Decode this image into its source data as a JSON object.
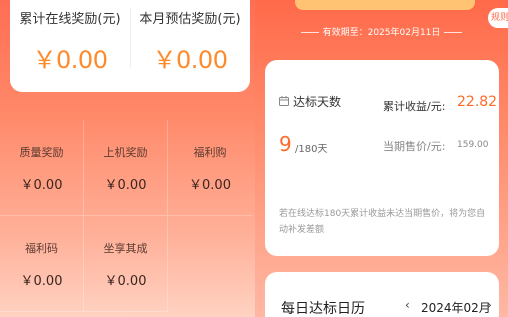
{
  "left": {
    "top_stats": [
      {
        "label": "累计在线奖励(元)",
        "value": "￥0.00"
      },
      {
        "label": "本月预估奖励(元)",
        "value": "￥0.00"
      }
    ],
    "rewards": [
      {
        "label": "质量奖励",
        "value": "￥0.00"
      },
      {
        "label": "上机奖励",
        "value": "￥0.00"
      },
      {
        "label": "福利购",
        "value": "￥0.00"
      },
      {
        "label": "福利码",
        "value": "￥0.00"
      },
      {
        "label": "坐享其成",
        "value": "￥0.00"
      }
    ]
  },
  "right": {
    "valid_until": "有效期至：2025年02月11日",
    "corner_badge": "规则",
    "days_label": "达标天数",
    "days_value": "9",
    "days_total": "/180天",
    "cumulative_label": "累计收益/元:",
    "cumulative_value": "22.82",
    "price_label": "当期售价/元:",
    "price_value": "159.00",
    "note": "若在线达标180天累计收益未达当期售价，将为您自动补发差额",
    "daily_title": "每日达标日历",
    "month": "2024年02月",
    "prev_symbol": "‹",
    "next_symbol": "›"
  },
  "colors": {
    "accent": "#ff6a2a",
    "gold": "#ff8a2a"
  }
}
